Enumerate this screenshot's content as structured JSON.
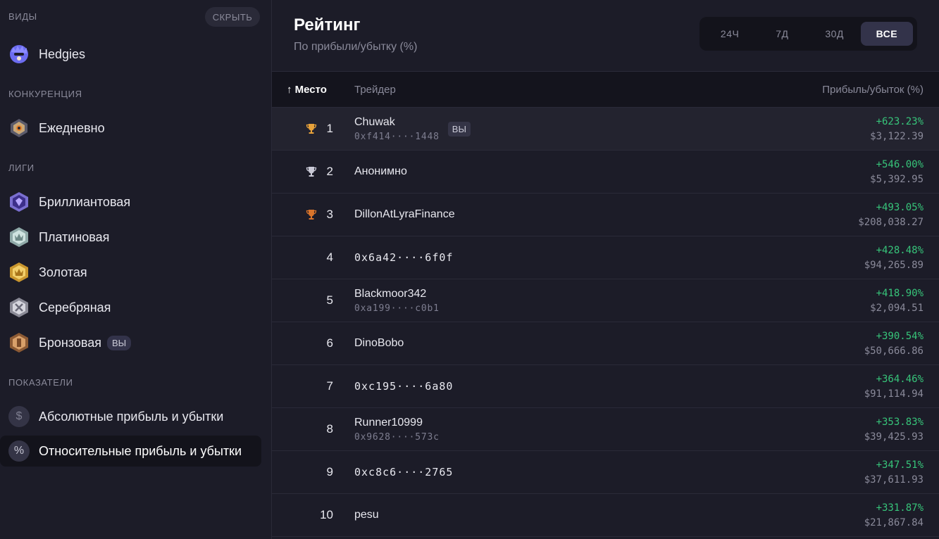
{
  "sidebar": {
    "views_header": "ВИДЫ",
    "hide_label": "СКРЫТЬ",
    "views": [
      {
        "label": "Hedgies",
        "icon": "hedgie-icon"
      }
    ],
    "competition_header": "КОНКУРЕНЦИЯ",
    "competition": [
      {
        "label": "Ежедневно",
        "icon": "daily-hex-icon"
      }
    ],
    "leagues_header": "ЛИГИ",
    "leagues": [
      {
        "label": "Бриллиантовая",
        "icon": "diamond-league-icon"
      },
      {
        "label": "Платиновая",
        "icon": "platinum-league-icon"
      },
      {
        "label": "Золотая",
        "icon": "gold-league-icon"
      },
      {
        "label": "Серебряная",
        "icon": "silver-league-icon"
      },
      {
        "label": "Бронзовая",
        "icon": "bronze-league-icon",
        "badge": "ВЫ"
      }
    ],
    "metrics_header": "ПОКАЗАТЕЛИ",
    "metrics": [
      {
        "label": "Абсолютные прибыль и убытки",
        "glyph": "$",
        "icon": "dollar-icon"
      },
      {
        "label": "Относительные прибыль и убытки",
        "glyph": "%",
        "icon": "percent-icon",
        "active": true
      }
    ]
  },
  "header": {
    "title": "Рейтинг",
    "subtitle": "По прибыли/убытку (%)",
    "periods": [
      "24Ч",
      "7Д",
      "30Д",
      "ВСЕ"
    ],
    "active_period": "ВСЕ"
  },
  "table": {
    "columns": {
      "rank": "↑ Место",
      "trader": "Трейдер",
      "pnl": "Прибыль/убыток (%)"
    },
    "you_label": "ВЫ",
    "colors": {
      "gold": "#e8a23a",
      "silver": "#c9c9d6",
      "bronze": "#d9742b",
      "positive": "#37c57a"
    },
    "rows": [
      {
        "rank": "1",
        "trophy": "gold",
        "name": "Chuwak",
        "addr": "0xf414····1448",
        "you": true,
        "pct": "+623.23%",
        "abs": "$3,122.39"
      },
      {
        "rank": "2",
        "trophy": "silver",
        "name": "Анонимно",
        "addr": "",
        "pct": "+546.00%",
        "abs": "$5,392.95"
      },
      {
        "rank": "3",
        "trophy": "bronze",
        "name": "DillonAtLyraFinance",
        "addr": "",
        "pct": "+493.05%",
        "abs": "$208,038.27"
      },
      {
        "rank": "4",
        "name": "0x6a42····6f0f",
        "mono": true,
        "addr": "",
        "pct": "+428.48%",
        "abs": "$94,265.89"
      },
      {
        "rank": "5",
        "name": "Blackmoor342",
        "addr": "0xa199····c0b1",
        "pct": "+418.90%",
        "abs": "$2,094.51"
      },
      {
        "rank": "6",
        "name": "DinoBobo",
        "addr": "",
        "pct": "+390.54%",
        "abs": "$50,666.86"
      },
      {
        "rank": "7",
        "name": "0xc195····6a80",
        "mono": true,
        "addr": "",
        "pct": "+364.46%",
        "abs": "$91,114.94"
      },
      {
        "rank": "8",
        "name": "Runner10999",
        "addr": "0x9628····573c",
        "pct": "+353.83%",
        "abs": "$39,425.93"
      },
      {
        "rank": "9",
        "name": "0xc8c6····2765",
        "mono": true,
        "addr": "",
        "pct": "+347.51%",
        "abs": "$37,611.93"
      },
      {
        "rank": "10",
        "name": "pesu",
        "addr": "",
        "pct": "+331.87%",
        "abs": "$21,867.84"
      }
    ]
  }
}
